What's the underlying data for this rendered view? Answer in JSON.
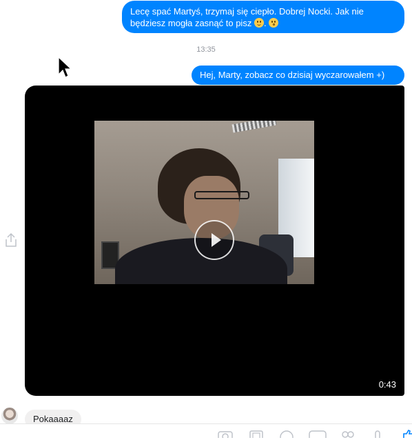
{
  "messages": {
    "outgoing_1": {
      "text_before_emoji": "Lecę spać Martyś, trzymaj się ciepło. Dobrej Nocki. Jak nie będziesz mogła zasnąć to pisz ",
      "text_between_emoji": ". ",
      "emojis": [
        "smiling-face-icon",
        "kissing-face-icon"
      ]
    },
    "timestamp": "13:35",
    "outgoing_2": {
      "text": "Hej, Marty, zobacz co dzisiaj wyczarowałem +)"
    },
    "video": {
      "duration": "0:43"
    },
    "incoming_1": {
      "text": "Pokaaaaz"
    }
  },
  "icons": {
    "share": "share-icon",
    "play": "play-icon",
    "cursor": "mouse-pointer-icon",
    "composer_tools": [
      "camera-icon",
      "gallery-icon",
      "sticker-icon",
      "gif-icon",
      "emoji-icon",
      "microphone-icon",
      "thumbs-up-icon"
    ]
  },
  "colors": {
    "outgoing_bubble": "#0084ff",
    "incoming_bubble": "#f1f0f0",
    "video_background": "#000000",
    "timestamp": "#90949c"
  }
}
